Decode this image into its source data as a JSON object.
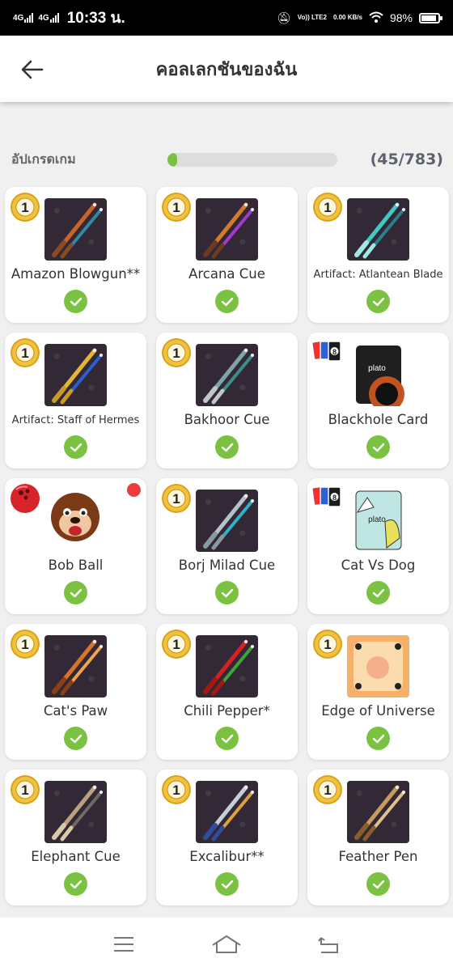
{
  "status_bar": {
    "network_1": "4G",
    "network_2": "4G",
    "time": "10:33 น.",
    "volte": "Vo)) LTE2",
    "speed": "0.00 KB/s",
    "battery": "98%"
  },
  "header": {
    "title": "คอลเลกชันของฉัน",
    "back_icon": "arrow-left-icon"
  },
  "upgrade": {
    "label": "อัปเกรดเกม",
    "progress_fraction": 0.0575,
    "count": "(45/783)",
    "accent_color": "#7cc242"
  },
  "items": [
    {
      "name": "Amazon Blowgun**",
      "badge": "coin-1",
      "icon": "blowgun-cue-icon"
    },
    {
      "name": "Arcana Cue",
      "badge": "coin-1",
      "icon": "arcana-cue-icon"
    },
    {
      "name": "Artifact: Atlantean Blade",
      "badge": "coin-1",
      "icon": "atlantean-blade-icon"
    },
    {
      "name": "Artifact: Staff of Hermes",
      "badge": "coin-1",
      "icon": "staff-of-hermes-icon"
    },
    {
      "name": "Bakhoor Cue",
      "badge": "coin-1",
      "icon": "bakhoor-cue-icon"
    },
    {
      "name": "Blackhole Card",
      "badge": "uno-cards",
      "icon": "plato-blackhole-card-icon",
      "logo": "plato"
    },
    {
      "name": "Bob Ball",
      "badge": "bowling-ball",
      "icon": "bob-ball-icon",
      "new_dot": true
    },
    {
      "name": "Borj Milad Cue",
      "badge": "coin-1",
      "icon": "borj-milad-cue-icon"
    },
    {
      "name": "Cat Vs Dog",
      "badge": "uno-cards",
      "icon": "plato-cat-vs-dog-card-icon",
      "logo": "plato"
    },
    {
      "name": "Cat's Paw",
      "badge": "coin-1",
      "icon": "cats-paw-cue-icon"
    },
    {
      "name": "Chili Pepper*",
      "badge": "coin-1",
      "icon": "chili-pepper-cue-icon"
    },
    {
      "name": "Edge of Universe",
      "badge": "coin-1",
      "icon": "edge-of-universe-table-icon"
    },
    {
      "name": "Elephant Cue",
      "badge": "coin-1",
      "icon": "elephant-cue-icon"
    },
    {
      "name": "Excalibur**",
      "badge": "coin-1",
      "icon": "excalibur-cue-icon"
    },
    {
      "name": "Feather Pen",
      "badge": "coin-1",
      "icon": "feather-pen-cue-icon"
    }
  ],
  "coin_number": "1",
  "uno_number": "8",
  "navbar": [
    "menu-icon",
    "home-icon",
    "back-icon"
  ]
}
